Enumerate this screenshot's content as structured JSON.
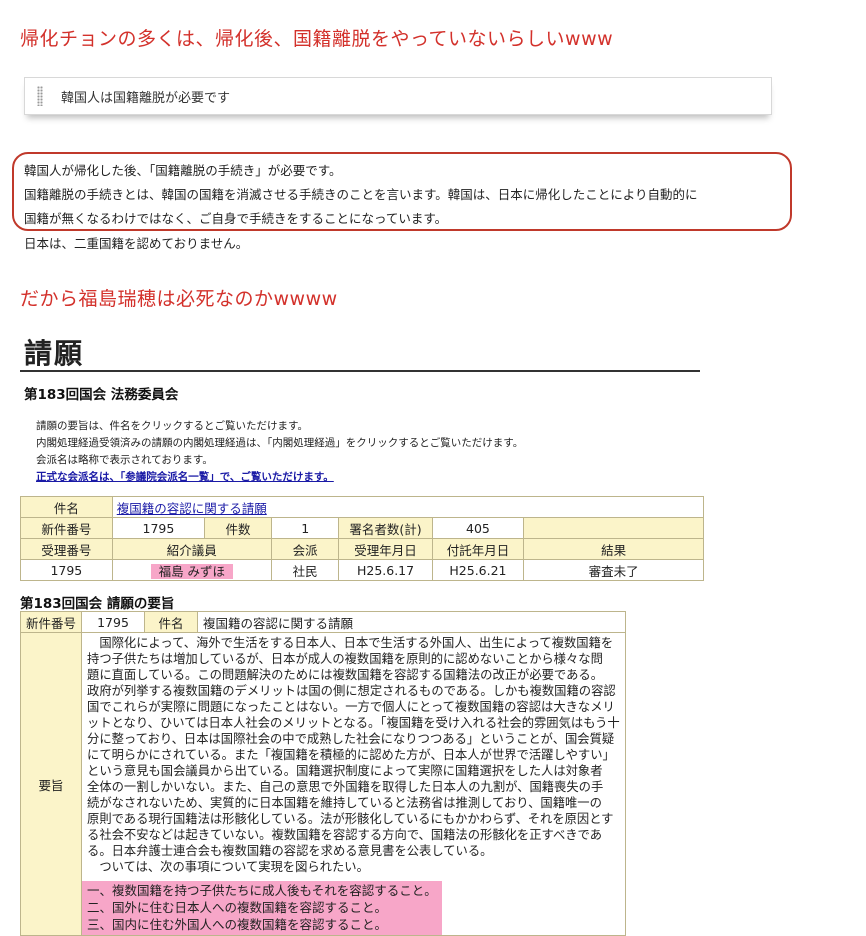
{
  "headings": {
    "first": "帰化チョンの多くは、帰化後、国籍離脱をやっていないらしいwww",
    "second": "だから福島瑞穂は必死なのかwwww"
  },
  "quote": {
    "text": "韓国人は国籍離脱が必要です"
  },
  "paragraphs": [
    "韓国人が帰化した後、「国籍離脱の手続き」が必要です。",
    "国籍離脱の手続きとは、韓国の国籍を消滅させる手続きのことを言います。韓国は、日本に帰化したことにより自動的に",
    "国籍が無くなるわけではなく、ご自身で手続きをすることになっています。",
    "日本は、二重国籍を認めておりません。"
  ],
  "petition": {
    "title": "請願",
    "session_title": "第183回国会 法務委員会",
    "notes": [
      "請願の要旨は、件名をクリックするとご覧いただけます。",
      "内閣処理経過受領済みの請願の内閣処理経過は、「内閣処理経過」をクリックするとご覧いただけます。",
      "会派名は略称で表示されております。",
      "正式な会派名は、「参議院会派名一覧」で、ご覧いただけます。"
    ],
    "table": {
      "subject_label": "件名",
      "subject_value": "複国籍の容認に関する請願",
      "new_number_label": "新件番号",
      "new_number_value": "1795",
      "count_label": "件数",
      "count_value": "1",
      "signers_label": "署名者数(計)",
      "signers_value": "405",
      "headers": [
        "受理番号",
        "紹介議員",
        "会派",
        "受理年月日",
        "付託年月日",
        "結果"
      ],
      "row": [
        "1795",
        "福島 みずほ",
        "社民",
        "H25.6.17",
        "H25.6.21",
        "審査未了"
      ]
    },
    "gist_title": "第183回国会 請願の要旨",
    "gist": {
      "new_number_label": "新件番号",
      "new_number_value": "1795",
      "subject_label": "件名",
      "subject_value": "複国籍の容認に関する請願",
      "gist_label": "要旨",
      "body_lines": [
        "　国際化によって、海外で生活をする日本人、日本で生活する外国人、出生によって複数国籍を",
        "持つ子供たちは増加しているが、日本が成人の複数国籍を原則的に認めないことから様々な問",
        "題に直面している。この問題解決のためには複数国籍を容認する国籍法の改正が必要である。",
        "政府が列挙する複数国籍のデメリットは国の側に想定されるものである。しかも複数国籍の容認",
        "国でこれらが実際に問題になったことはない。一方で個人にとって複数国籍の容認は大きなメリ",
        "ットとなり、ひいては日本人社会のメリットとなる。「複国籍を受け入れる社会的雰囲気はもう十",
        "分に整っており、日本は国際社会の中で成熟した社会になりつつある」ということが、国会質疑",
        "にて明らかにされている。また「複国籍を積極的に認めた方が、日本人が世界で活躍しやすい」",
        "という意見も国会議員から出ている。国籍選択制度によって実際に国籍選択をした人は対象者",
        "全体の一割しかいない。また、自己の意思で外国籍を取得した日本人の九割が、国籍喪失の手",
        "続がなされないため、実質的に日本国籍を維持していると法務省は推測しており、国籍唯一の",
        "原則である現行国籍法は形骸化している。法が形骸化しているにもかかわらず、それを原因とす",
        "る社会不安などは起きていない。複数国籍を容認する方向で、国籍法の形骸化を正すべきであ",
        "る。日本弁護士連合会も複数国籍の容認を求める意見書を公表している。",
        "　ついては、次の事項について実現を図られたい。"
      ],
      "requests": [
        "一、複数国籍を持つ子供たちに成人後もそれを容認すること。",
        "二、国外に住む日本人への複数国籍を容認すること。",
        "三、国内に住む外国人への複数国籍を容認すること。"
      ]
    }
  }
}
